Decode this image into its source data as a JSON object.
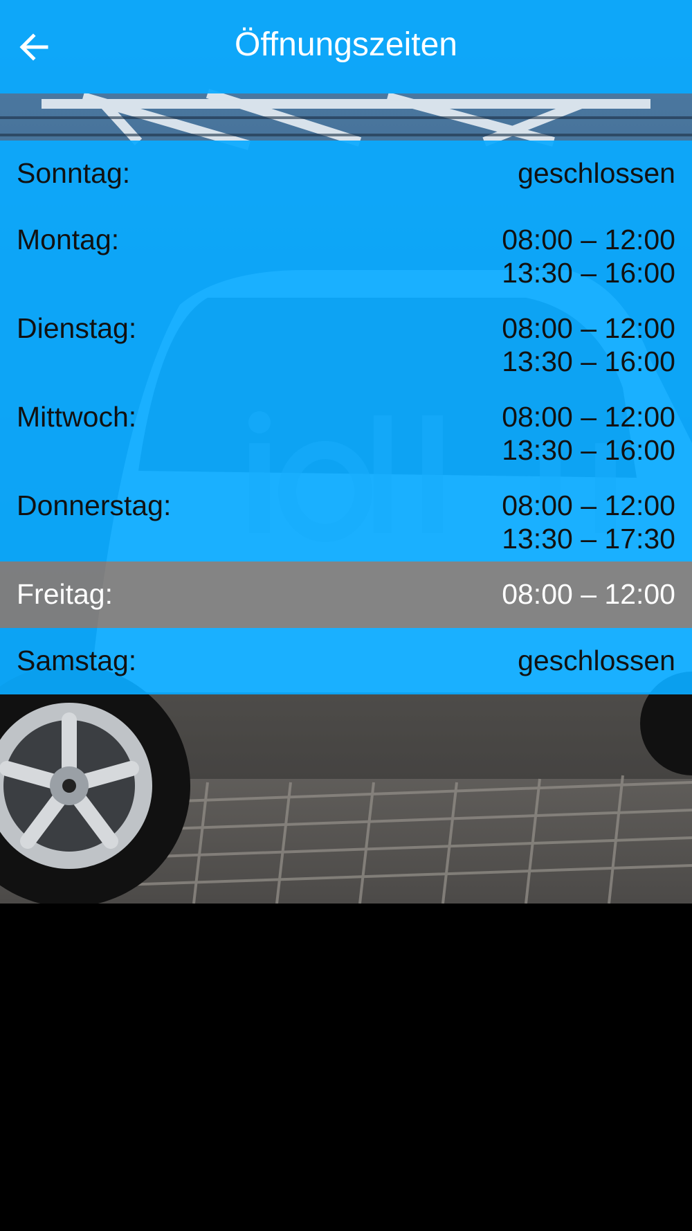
{
  "appbar": {
    "title": "Öffnungszeiten",
    "back_icon": "arrow-left-icon"
  },
  "colors": {
    "accent": "#0AAAFF",
    "highlight_row": "#808080",
    "title_text": "#FFFFFF",
    "row_text": "#111111"
  },
  "hours": [
    {
      "day": "Sonntag:",
      "times": [
        "geschlossen"
      ],
      "current": false
    },
    {
      "day": "Montag:",
      "times": [
        "08:00 – 12:00",
        "13:30 – 16:00"
      ],
      "current": false
    },
    {
      "day": "Dienstag:",
      "times": [
        "08:00 – 12:00",
        "13:30 – 16:00"
      ],
      "current": false
    },
    {
      "day": "Mittwoch:",
      "times": [
        "08:00 – 12:00",
        "13:30 – 16:00"
      ],
      "current": false
    },
    {
      "day": "Donnerstag:",
      "times": [
        "08:00 – 12:00",
        "13:30 – 17:30"
      ],
      "current": false
    },
    {
      "day": "Freitag:",
      "times": [
        "08:00 – 12:00"
      ],
      "current": true
    },
    {
      "day": "Samstag:",
      "times": [
        "geschlossen"
      ],
      "current": false
    }
  ]
}
